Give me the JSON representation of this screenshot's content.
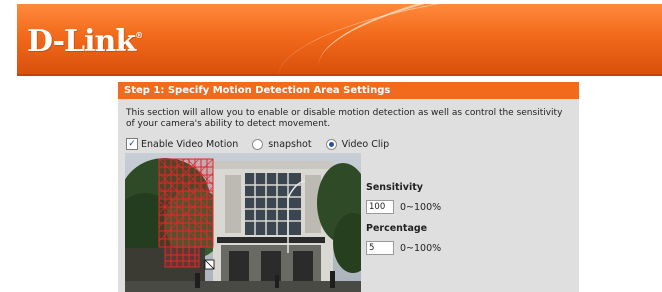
{
  "header": {
    "logo_text": "D-Link",
    "logo_mark": "®"
  },
  "panel": {
    "title": "Step 1: Specify Motion Detection Area Settings",
    "description": "This section will allow you to enable or disable motion detection as well as control the sensitivity of your camera's ability to detect movement.",
    "enable_checkbox": {
      "label": "Enable Video Motion",
      "checked": true
    },
    "radio_options": [
      {
        "label": "snapshot",
        "selected": false
      },
      {
        "label": "Video Clip",
        "selected": true
      }
    ],
    "sensitivity": {
      "label": "Sensitivity",
      "value": "100",
      "range": "0~100%"
    },
    "percentage": {
      "label": "Percentage",
      "value": "5",
      "range": "0~100%"
    }
  },
  "colors": {
    "accent": "#f26a1b",
    "panel_bg": "#dfdfdf",
    "grid": "#e0282c"
  }
}
